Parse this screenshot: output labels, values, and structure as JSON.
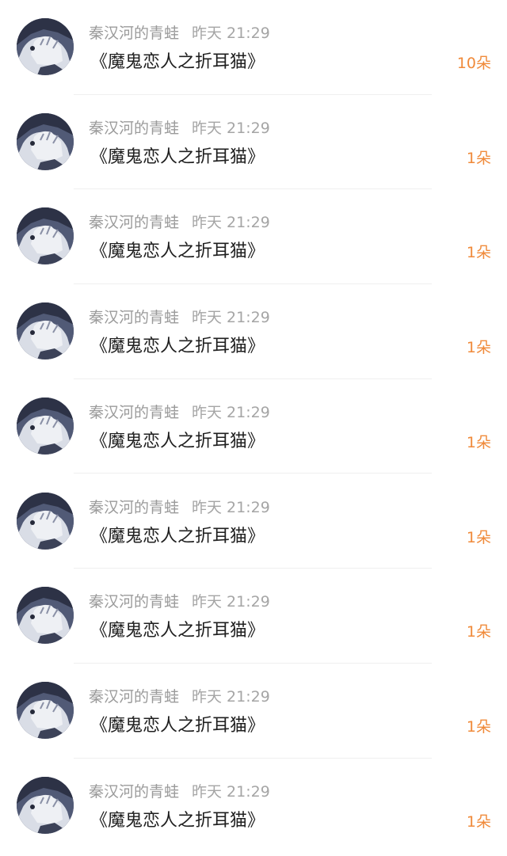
{
  "rows": [
    {
      "user": "秦汉河的青蛙",
      "time": "昨天 21:29",
      "title": "《魔鬼恋人之折耳猫》",
      "count": "10朵"
    },
    {
      "user": "秦汉河的青蛙",
      "time": "昨天 21:29",
      "title": "《魔鬼恋人之折耳猫》",
      "count": "1朵"
    },
    {
      "user": "秦汉河的青蛙",
      "time": "昨天 21:29",
      "title": "《魔鬼恋人之折耳猫》",
      "count": "1朵"
    },
    {
      "user": "秦汉河的青蛙",
      "time": "昨天 21:29",
      "title": "《魔鬼恋人之折耳猫》",
      "count": "1朵"
    },
    {
      "user": "秦汉河的青蛙",
      "time": "昨天 21:29",
      "title": "《魔鬼恋人之折耳猫》",
      "count": "1朵"
    },
    {
      "user": "秦汉河的青蛙",
      "time": "昨天 21:29",
      "title": "《魔鬼恋人之折耳猫》",
      "count": "1朵"
    },
    {
      "user": "秦汉河的青蛙",
      "time": "昨天 21:29",
      "title": "《魔鬼恋人之折耳猫》",
      "count": "1朵"
    },
    {
      "user": "秦汉河的青蛙",
      "time": "昨天 21:29",
      "title": "《魔鬼恋人之折耳猫》",
      "count": "1朵"
    },
    {
      "user": "秦汉河的青蛙",
      "time": "昨天 21:29",
      "title": "《魔鬼恋人之折耳猫》",
      "count": "1朵"
    }
  ],
  "colors": {
    "count": "#f08a3a",
    "meta": "#9b9b9b",
    "title": "#1f1f1f"
  }
}
